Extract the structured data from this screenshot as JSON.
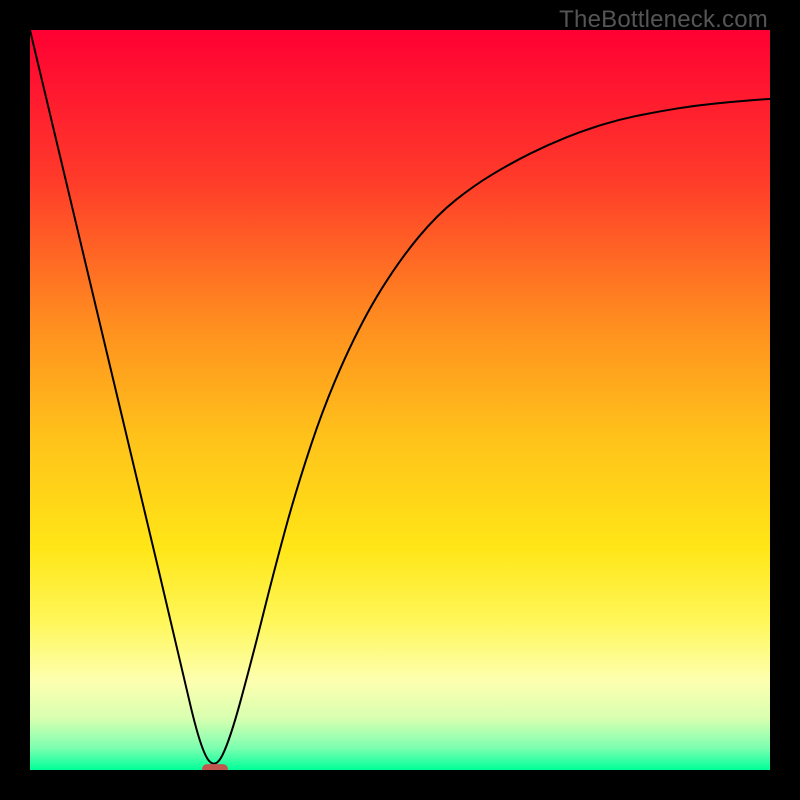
{
  "watermark": "TheBottleneck.com",
  "chart_data": {
    "type": "line",
    "title": "",
    "xlabel": "",
    "ylabel": "",
    "xlim": [
      0,
      100
    ],
    "ylim": [
      0,
      100
    ],
    "grid": false,
    "legend": false,
    "background": {
      "type": "vertical-gradient",
      "stops": [
        {
          "pos": 0.0,
          "color": "#ff0033"
        },
        {
          "pos": 0.2,
          "color": "#ff3a2a"
        },
        {
          "pos": 0.4,
          "color": "#ff8f1f"
        },
        {
          "pos": 0.55,
          "color": "#ffc21a"
        },
        {
          "pos": 0.7,
          "color": "#ffe617"
        },
        {
          "pos": 0.8,
          "color": "#fff75a"
        },
        {
          "pos": 0.88,
          "color": "#fdffb0"
        },
        {
          "pos": 0.93,
          "color": "#d9ffb0"
        },
        {
          "pos": 0.97,
          "color": "#7dffb0"
        },
        {
          "pos": 1.0,
          "color": "#00ff99"
        }
      ]
    },
    "series": [
      {
        "name": "bottleneck-curve",
        "stroke": "#000000",
        "stroke_width": 2,
        "x": [
          0,
          5,
          10,
          15,
          20,
          23,
          25,
          27,
          30,
          33,
          36,
          40,
          45,
          50,
          55,
          60,
          65,
          70,
          75,
          80,
          85,
          90,
          95,
          100
        ],
        "y": [
          100,
          79,
          58,
          37,
          16,
          3,
          0,
          4,
          15,
          27,
          38,
          50,
          61,
          69,
          75,
          79,
          82,
          84.5,
          86.5,
          88,
          89,
          89.8,
          90.3,
          90.7
        ]
      }
    ],
    "marker": {
      "name": "optimal-point",
      "x": 25,
      "y": 0,
      "shape": "rounded-rect",
      "width": 3.5,
      "height": 1.6,
      "fill": "#c1564f"
    }
  }
}
